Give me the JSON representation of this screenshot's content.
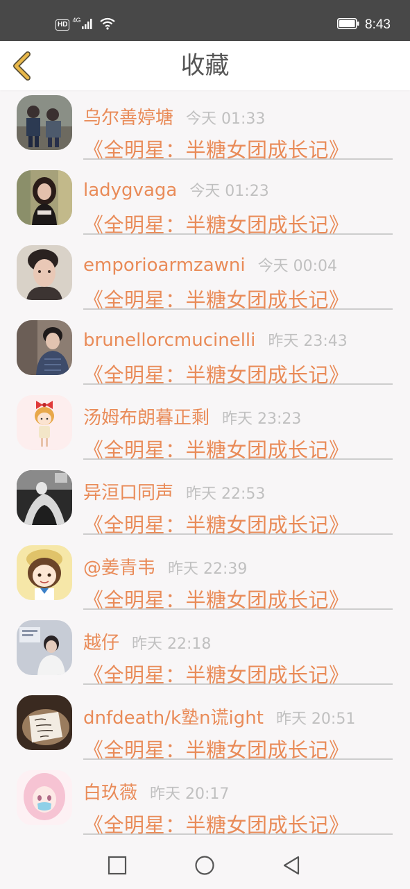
{
  "status_bar": {
    "hd": "HD",
    "network": "4G",
    "time": "8:43"
  },
  "header": {
    "title": "收藏",
    "back_icon": "chevron-left-icon",
    "accent_color": "#e9b84a"
  },
  "favorites": [
    {
      "user": "乌尔善婷塘",
      "time": "今天 01:33",
      "collection": "《全明星：半糖女团成长记》"
    },
    {
      "user": "ladygvaga",
      "time": "今天 01:23",
      "collection": "《全明星：半糖女团成长记》"
    },
    {
      "user": "emporioarmzawni",
      "time": "今天 00:04",
      "collection": "《全明星：半糖女团成长记》"
    },
    {
      "user": "brunellorcmucinelli",
      "time": "昨天 23:43",
      "collection": "《全明星：半糖女团成长记》"
    },
    {
      "user": "汤姆布朗暮正剩",
      "time": "昨天 23:23",
      "collection": "《全明星：半糖女团成长记》"
    },
    {
      "user": "异洹口同声",
      "time": "昨天 22:53",
      "collection": "《全明星：半糖女团成长记》"
    },
    {
      "user": "@姜青韦",
      "time": "昨天 22:39",
      "collection": "《全明星：半糖女团成长记》"
    },
    {
      "user": "越仔",
      "time": "昨天 22:18",
      "collection": "《全明星：半糖女团成长记》"
    },
    {
      "user": "dnfdeath/k塾n谎ight",
      "time": "昨天 20:51",
      "collection": "《全明星：半糖女团成长记》"
    },
    {
      "user": "白玖薇",
      "time": "昨天 20:17",
      "collection": "《全明星：半糖女团成长记》"
    }
  ],
  "colors": {
    "name_text": "#e98b58",
    "time_text": "#c0c0c0",
    "status_bar_bg": "#484848",
    "list_bg": "#f8f6f7"
  },
  "nav": {
    "icons": [
      "recent-apps-icon",
      "home-icon",
      "back-icon"
    ]
  }
}
